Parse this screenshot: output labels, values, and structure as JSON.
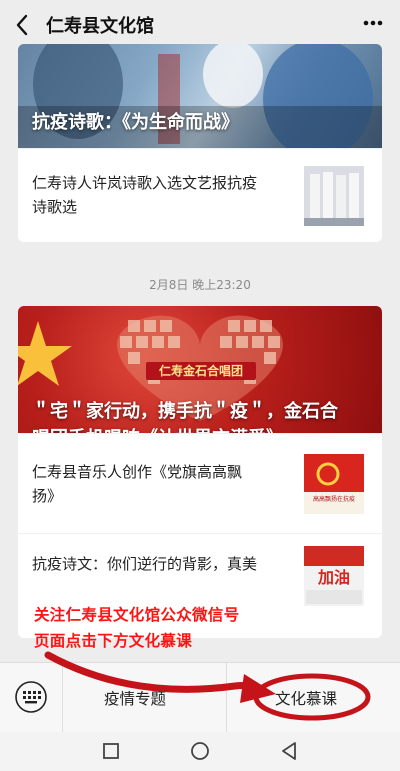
{
  "header": {
    "title": "仁寿县文化馆"
  },
  "card1": {
    "hero_caption": "抗疫诗歌：《为生命而战》",
    "rows": [
      {
        "text_line1": "仁寿诗人许岚诗歌入选文艺报抗疫",
        "text_line2": "诗歌选"
      }
    ]
  },
  "timestamp": "2月8日 晚上23:20",
  "card2": {
    "banner_text": "仁寿金石合唱团",
    "hero_caption_line1": "＂宅＂家行动，携手抗＂疫＂，金石合",
    "hero_caption_line2": "唱团手机唱响《让世界充满爱》",
    "rows": [
      {
        "text_line1": "仁寿县音乐人创作《党旗高高飘",
        "text_line2": "扬》",
        "thumb_text": "高高飘扬在抗疫"
      },
      {
        "text_line1": "抗疫诗文：你们逆行的背影，真美",
        "thumb_text": "加油"
      }
    ]
  },
  "overlay": {
    "line1": "关注仁寿县文化馆公众微信号",
    "line2": "页面点击下方文化慕课"
  },
  "bottom_menu": {
    "items": [
      "疫情专题",
      "文化慕课"
    ]
  },
  "icons": {
    "back": "back-arrow-icon",
    "more": "more-dots-icon",
    "keyboard": "keyboard-icon",
    "nav_square": "recent-apps-icon",
    "nav_circle": "home-icon",
    "nav_triangle": "back-nav-icon"
  },
  "colors": {
    "accent_red": "#ff1414",
    "annotation_red": "#c4141a",
    "background": "#ededed"
  }
}
